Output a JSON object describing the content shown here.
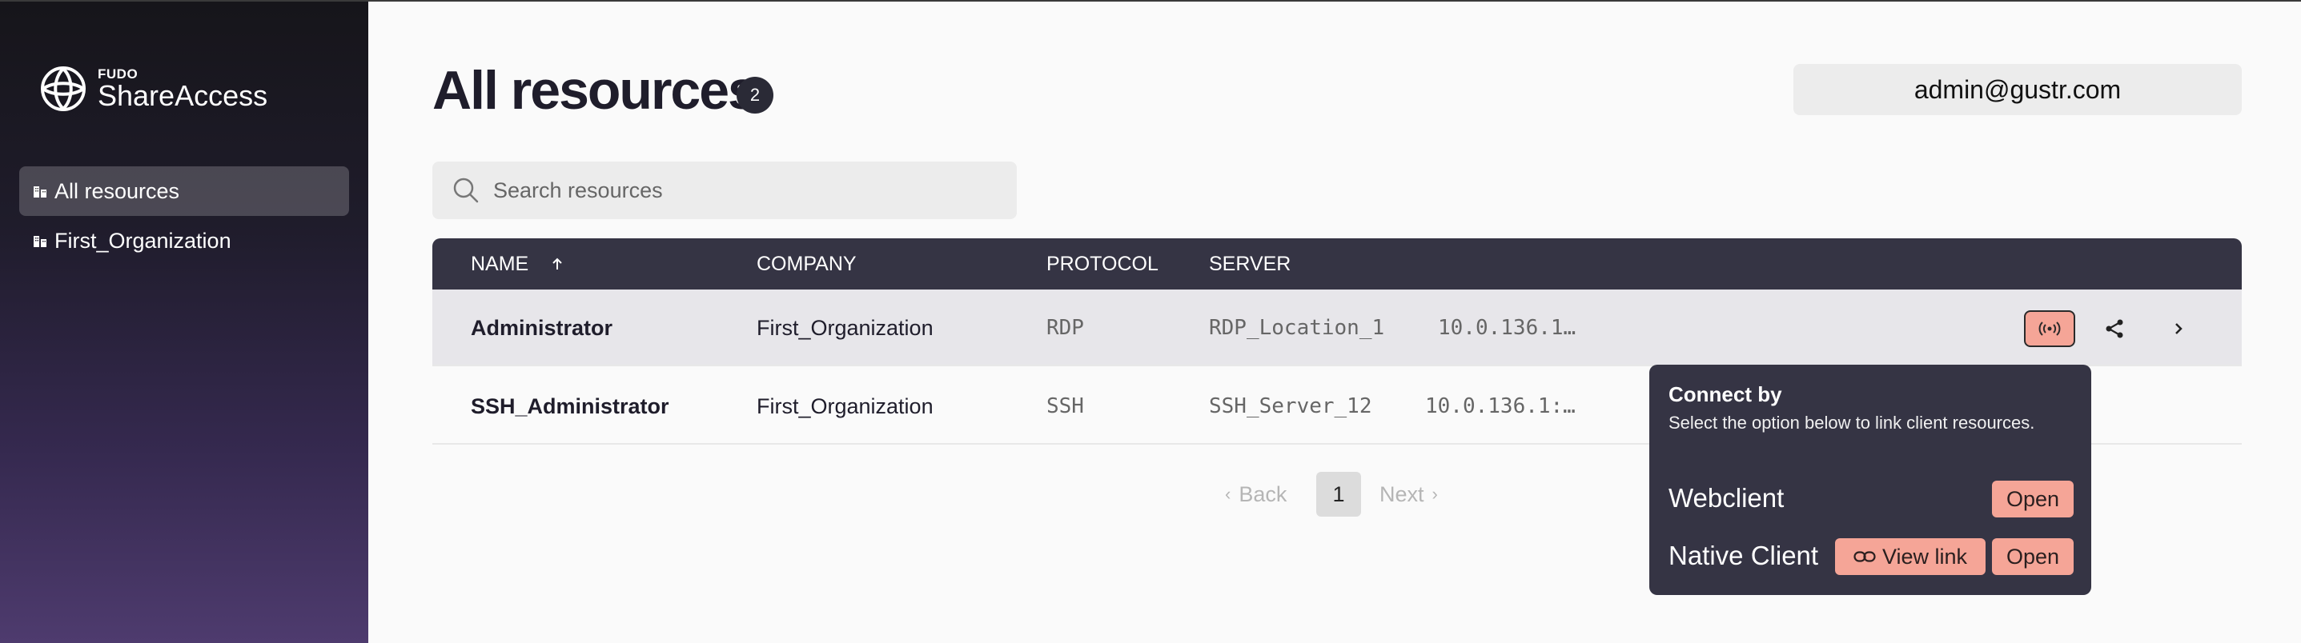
{
  "brand": {
    "small": "FUDO",
    "name": "ShareAccess"
  },
  "sidebar": {
    "items": [
      {
        "label": "All resources",
        "icon": "building-icon"
      },
      {
        "label": "First_Organization",
        "icon": "building-icon"
      }
    ]
  },
  "header": {
    "title": "All resources",
    "count": "2",
    "user": "admin@gustr.com"
  },
  "search": {
    "placeholder": "Search resources",
    "value": ""
  },
  "table": {
    "columns": [
      "NAME",
      "COMPANY",
      "PROTOCOL",
      "SERVER"
    ],
    "sort_icon": "arrow-up-icon",
    "rows": [
      {
        "name": "Administrator",
        "company": "First_Organization",
        "protocol": "RDP",
        "server": "RDP_Location_1",
        "address": "10.0.136.1…"
      },
      {
        "name": "SSH_Administrator",
        "company": "First_Organization",
        "protocol": "SSH",
        "server": "SSH_Server_12",
        "address": "10.0.136.1:…"
      }
    ]
  },
  "pagination": {
    "back": "Back",
    "next": "Next",
    "current": "1"
  },
  "popover": {
    "title": "Connect by",
    "description": "Select the option below to link client resources.",
    "webclient_label": "Webclient",
    "webclient_open": "Open",
    "native_label": "Native Client",
    "view_link": "View link",
    "native_open": "Open"
  },
  "colors": {
    "sidebar_top": "#16151a",
    "sidebar_bottom": "#4e3b6e",
    "table_header": "#353444",
    "accent": "#f5a597"
  }
}
